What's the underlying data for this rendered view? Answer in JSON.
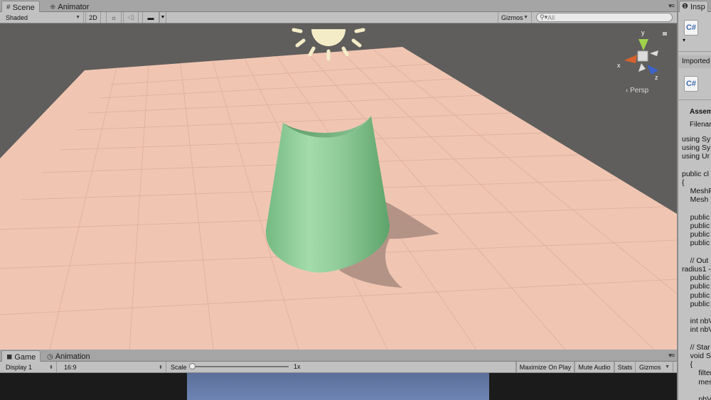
{
  "scene_panel": {
    "tabs": [
      {
        "label": "Scene",
        "icon": "grid-icon"
      },
      {
        "label": "Animator",
        "icon": "animator-icon"
      }
    ],
    "toolbar": {
      "shading_mode": "Shaded",
      "mode_2d": "2D",
      "lighting_icon": "sun-icon",
      "audio_icon": "speaker-icon",
      "effects_icon": "image-icon",
      "gizmos_label": "Gizmos",
      "search_placeholder": "All"
    },
    "viewport": {
      "projection_label": "‹ Persp",
      "gizmo_axes": {
        "x": "x",
        "y": "y",
        "z": "z"
      },
      "colors": {
        "ground": "#f0c6b3",
        "cone": "#8ecb98",
        "background": "#5f5e5c",
        "sun": "#f4ecc7"
      }
    }
  },
  "game_panel": {
    "tabs": [
      {
        "label": "Game",
        "icon": "game-icon"
      },
      {
        "label": "Animation",
        "icon": "clock-icon"
      }
    ],
    "toolbar": {
      "display": "Display 1",
      "aspect": "16:9",
      "scale_label": "Scale",
      "scale_value": "1x",
      "maximize_on_play": "Maximize On Play",
      "mute_audio": "Mute Audio",
      "stats": "Stats",
      "gizmos": "Gizmos"
    }
  },
  "inspector": {
    "tab_label": "Insp",
    "imported_label": "Imported",
    "assembly_label": "Assem",
    "filename_label": "Filenan",
    "code_lines": [
      "using Sy",
      "using Sy",
      "using Ur",
      "",
      "public cl",
      "{",
      "    MeshF",
      "    Mesh r",
      "",
      "    public",
      "    public",
      "    public",
      "    public",
      "",
      "    // Out",
      "radius1 -",
      "    public",
      "    public",
      "    public",
      "    public",
      "",
      "    int nbV",
      "    int nbV",
      "",
      "    // Star",
      "    void St",
      "    {",
      "        filter",
      "        mes",
      "",
      "        nbV"
    ]
  }
}
